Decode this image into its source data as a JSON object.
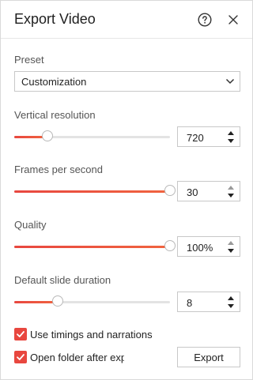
{
  "dialog": {
    "title": "Export Video",
    "help_icon": "help-circle-icon",
    "close_icon": "close-icon"
  },
  "preset": {
    "label": "Preset",
    "value": "Customization"
  },
  "vertical_resolution": {
    "label": "Vertical resolution",
    "value": "720",
    "level": 0.19
  },
  "frames_per_second": {
    "label": "Frames per second",
    "value": "30",
    "level": 1.0
  },
  "quality": {
    "label": "Quality",
    "value": "100%",
    "level": 1.0
  },
  "slide_duration": {
    "label": "Default slide duration",
    "value": "8",
    "level": 0.26
  },
  "options": {
    "use_timings_label": "Use timings and narrations",
    "use_timings_checked": true,
    "open_folder_label": "Open folder after export",
    "open_folder_checked": true
  },
  "export_button_label": "Export",
  "colors": {
    "accent": "#e8473f",
    "track": "#e3e3e3"
  }
}
